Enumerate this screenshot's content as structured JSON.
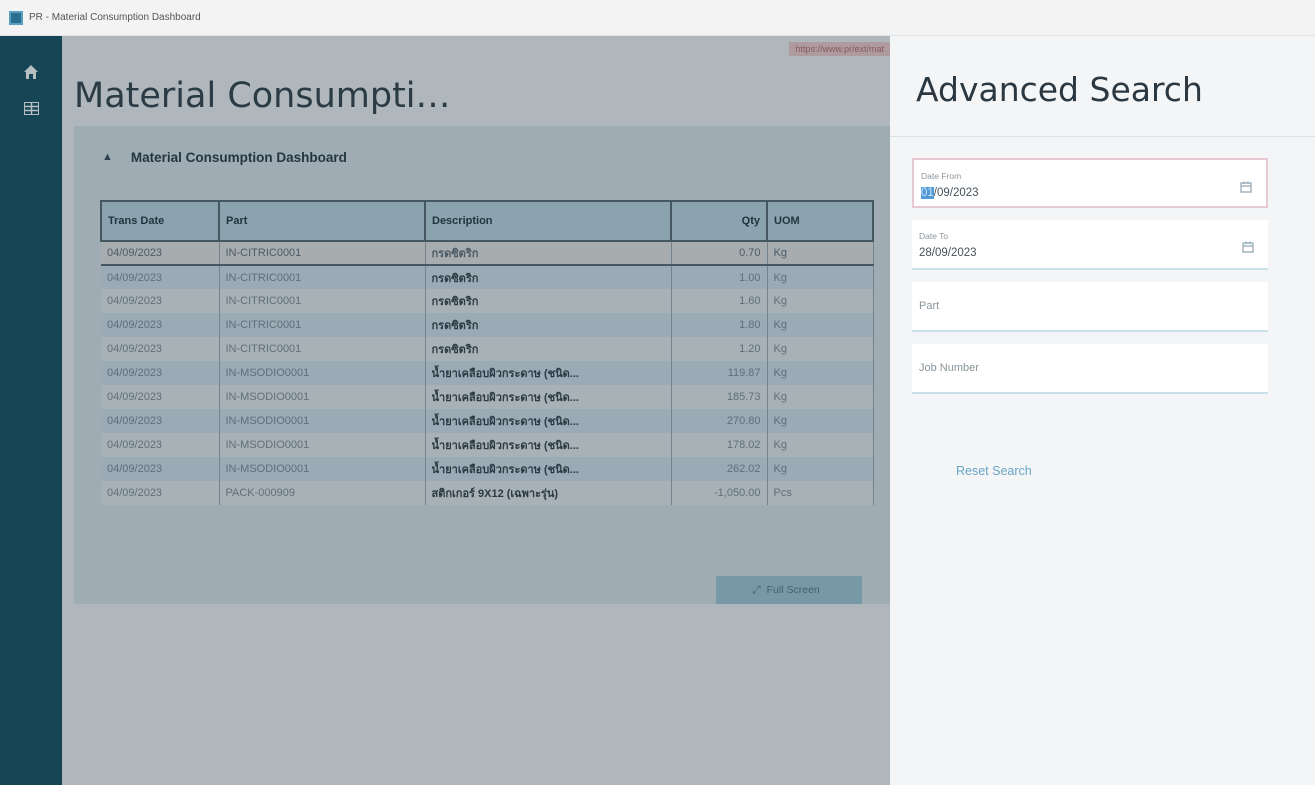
{
  "window": {
    "title": "PR - Material Consumption Dashboard"
  },
  "nav": [
    {
      "icon": "home-icon"
    },
    {
      "icon": "grid-icon"
    }
  ],
  "main": {
    "url_badge": "https://www.pr/ext/mat",
    "page_title": "Material Consumpti…",
    "panel_title": "Material Consumption Dashboard",
    "columns": [
      "Trans Date",
      "Part",
      "Description",
      "Qty",
      "UOM"
    ],
    "rows": [
      {
        "date": "04/09/2023",
        "part": "IN-CITRIC0001",
        "desc": "กรดซิตริก",
        "qty": "0.70",
        "uom": "Kg"
      },
      {
        "date": "04/09/2023",
        "part": "IN-CITRIC0001",
        "desc": "กรดซิตริก",
        "qty": "1.00",
        "uom": "Kg"
      },
      {
        "date": "04/09/2023",
        "part": "IN-CITRIC0001",
        "desc": "กรดซิตริก",
        "qty": "1.60",
        "uom": "Kg"
      },
      {
        "date": "04/09/2023",
        "part": "IN-CITRIC0001",
        "desc": "กรดซิตริก",
        "qty": "1.80",
        "uom": "Kg"
      },
      {
        "date": "04/09/2023",
        "part": "IN-CITRIC0001",
        "desc": "กรดซิตริก",
        "qty": "1.20",
        "uom": "Kg"
      },
      {
        "date": "04/09/2023",
        "part": "IN-MSODIO0001",
        "desc": "น้ำยาเคลือบผิวกระดาษ (ชนิด...",
        "qty": "119.87",
        "uom": "Kg"
      },
      {
        "date": "04/09/2023",
        "part": "IN-MSODIO0001",
        "desc": "น้ำยาเคลือบผิวกระดาษ (ชนิด...",
        "qty": "185.73",
        "uom": "Kg"
      },
      {
        "date": "04/09/2023",
        "part": "IN-MSODIO0001",
        "desc": "น้ำยาเคลือบผิวกระดาษ (ชนิด...",
        "qty": "270.80",
        "uom": "Kg"
      },
      {
        "date": "04/09/2023",
        "part": "IN-MSODIO0001",
        "desc": "น้ำยาเคลือบผิวกระดาษ (ชนิด...",
        "qty": "178.02",
        "uom": "Kg"
      },
      {
        "date": "04/09/2023",
        "part": "IN-MSODIO0001",
        "desc": "น้ำยาเคลือบผิวกระดาษ (ชนิด...",
        "qty": "262.02",
        "uom": "Kg"
      },
      {
        "date": "04/09/2023",
        "part": "PACK-000909",
        "desc": "สติกเกอร์ 9X12 (เฉพาะรุ่น)",
        "qty": "-1,050.00",
        "uom": "Pcs"
      }
    ],
    "fullscreen_label": "Full Screen"
  },
  "drawer": {
    "title": "Advanced Search",
    "date_from_label": "Date From",
    "date_from_day": "01",
    "date_from_rest": "/09/2023",
    "date_to_label": "Date To",
    "date_to_value": "28/09/2023",
    "part_placeholder": "Part",
    "job_placeholder": "Job Number",
    "reset_label": "Reset Search"
  },
  "colors": {
    "sidebar": "#0e4a5c",
    "accent": "#6aa6c6",
    "header": "#bcd6e2"
  }
}
